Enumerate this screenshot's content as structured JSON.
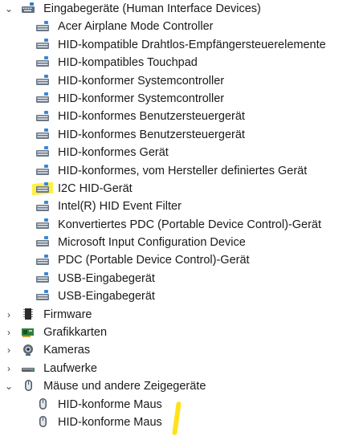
{
  "hid_category": {
    "label": "Eingabegeräte (Human Interface Devices)",
    "expanded": true,
    "icon": "hid-keyboard-icon",
    "children": [
      {
        "label": "Acer Airplane Mode Controller",
        "icon": "hid-device-icon"
      },
      {
        "label": "HID-kompatible Drahtlos-Empfängersteuerelemente",
        "icon": "hid-device-icon"
      },
      {
        "label": "HID-kompatibles Touchpad",
        "icon": "hid-device-icon"
      },
      {
        "label": "HID-konformer Systemcontroller",
        "icon": "hid-device-icon"
      },
      {
        "label": "HID-konformer Systemcontroller",
        "icon": "hid-device-icon"
      },
      {
        "label": "HID-konformes Benutzersteuergerät",
        "icon": "hid-device-icon"
      },
      {
        "label": "HID-konformes Benutzersteuergerät",
        "icon": "hid-device-icon"
      },
      {
        "label": "HID-konformes Gerät",
        "icon": "hid-device-icon"
      },
      {
        "label": "HID-konformes, vom Hersteller definiertes Gerät",
        "icon": "hid-device-icon"
      },
      {
        "label": "I2C HID-Gerät",
        "icon": "hid-device-icon",
        "highlighted": true
      },
      {
        "label": "Intel(R) HID Event Filter",
        "icon": "hid-device-icon"
      },
      {
        "label": "Konvertiertes PDC (Portable Device Control)-Gerät",
        "icon": "hid-device-icon"
      },
      {
        "label": "Microsoft Input Configuration Device",
        "icon": "hid-device-icon"
      },
      {
        "label": "PDC (Portable Device Control)-Gerät",
        "icon": "hid-device-icon"
      },
      {
        "label": "USB-Eingabegerät",
        "icon": "hid-device-icon"
      },
      {
        "label": "USB-Eingabegerät",
        "icon": "hid-device-icon"
      }
    ]
  },
  "collapsed_categories": [
    {
      "label": "Firmware",
      "icon": "firmware-chip-icon"
    },
    {
      "label": "Grafikkarten",
      "icon": "display-adapter-icon"
    },
    {
      "label": "Kameras",
      "icon": "camera-icon"
    },
    {
      "label": "Laufwerke",
      "icon": "disk-drive-icon"
    }
  ],
  "mouse_category": {
    "label": "Mäuse und andere Zeigegeräte",
    "expanded": true,
    "icon": "mouse-icon",
    "children": [
      {
        "label": "HID-konforme Maus",
        "icon": "mouse-icon"
      },
      {
        "label": "HID-konforme Maus",
        "icon": "mouse-icon"
      }
    ]
  },
  "glyphs": {
    "expanded": "⌄",
    "collapsed": "›"
  },
  "colors": {
    "highlight": "#ffef3a",
    "text": "#1a1a1a"
  }
}
